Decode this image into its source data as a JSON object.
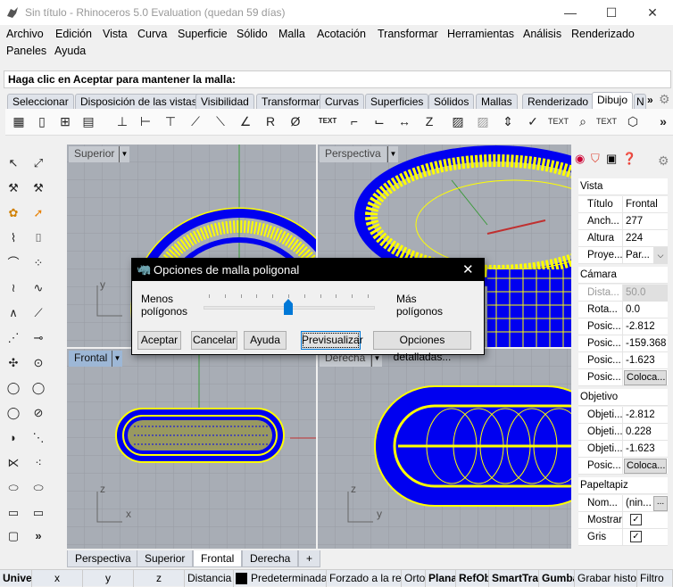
{
  "window": {
    "title": "Sin título - Rhinoceros 5.0 Evaluation (quedan 59 días)",
    "minimize": "—",
    "maximize": "☐",
    "close": "✕"
  },
  "menu": {
    "row1": [
      "Archivo",
      "Edición",
      "Vista",
      "Curva",
      "Superficie",
      "Sólido",
      "Malla",
      "Acotación",
      "Transformar",
      "Herramientas",
      "Análisis",
      "Renderizado"
    ],
    "row2": [
      "Paneles",
      "Ayuda"
    ]
  },
  "command": {
    "prompt": "Haga clic en Aceptar para mantener la malla:"
  },
  "toolbar_tabs": [
    {
      "label": "Seleccionar"
    },
    {
      "label": "Disposición de las vistas"
    },
    {
      "label": "Visibilidad"
    },
    {
      "label": "Transformar"
    },
    {
      "label": "Curvas"
    },
    {
      "label": "Superficies"
    },
    {
      "label": "Sólidos"
    },
    {
      "label": "Mallas"
    },
    {
      "label": "Renderizado"
    },
    {
      "label": "Dibujo",
      "active": true
    },
    {
      "label": "N"
    }
  ],
  "toolbar_more": "»",
  "toolbar_icons": [
    "layout-icon",
    "page-icon",
    "add-page-icon",
    "page-properties-icon",
    "dimension-vertical-icon",
    "dimension-horizontal-icon",
    "dimension-icon",
    "dimension-aligned-icon",
    "dimension-rotated-icon",
    "angle-45-icon",
    "radius-icon",
    "diameter-icon",
    "text-icon",
    "leader-2-icon",
    "leader-icon",
    "dimension-text-icon",
    "dimension-z-icon",
    "hatch-icon",
    "hatch-gray-icon",
    "dimension-edit-icon",
    "dimension-check-icon",
    "text-edit-icon",
    "text-find-icon",
    "text-text-icon",
    "make2d-icon"
  ],
  "toolbar_text": {
    "text1": "TEXT",
    "text2": "TEXT",
    "text3": "TEXT"
  },
  "viewports": {
    "top_left": {
      "label": "Superior",
      "axes": [
        "y",
        "x"
      ]
    },
    "top_right": {
      "label": "Perspectiva"
    },
    "bottom_left": {
      "label": "Frontal",
      "axes": [
        "z",
        "x"
      ],
      "active": true
    },
    "bottom_right": {
      "label": "Derecha",
      "axes": [
        "z",
        "y"
      ]
    }
  },
  "viewport_tabs": [
    {
      "label": "Perspectiva"
    },
    {
      "label": "Superior"
    },
    {
      "label": "Frontal",
      "active": true
    },
    {
      "label": "Derecha"
    }
  ],
  "viewport_tab_add": "+",
  "panel": {
    "sections": {
      "vista": "Vista",
      "camara": "Cámara",
      "objetivo": "Objetivo",
      "papeltapiz": "Papeltapiz"
    },
    "vista": [
      [
        "Título",
        "Frontal"
      ],
      [
        "Anch...",
        "277"
      ],
      [
        "Altura",
        "224"
      ],
      [
        "Proye...",
        "Par..."
      ]
    ],
    "camara": [
      [
        "Dista...",
        "50.0"
      ],
      [
        "Rota...",
        "0.0"
      ],
      [
        "Posic...",
        "-2.812"
      ],
      [
        "Posic...",
        "-159.368"
      ],
      [
        "Posic...",
        "-1.623"
      ],
      [
        "Posic...",
        "Coloca..."
      ]
    ],
    "objetivo": [
      [
        "Objeti...",
        "-2.812"
      ],
      [
        "Objeti...",
        "0.228"
      ],
      [
        "Objeti...",
        "-1.623"
      ],
      [
        "Posic...",
        "Coloca..."
      ]
    ],
    "papeltapiz": [
      [
        "Nom...",
        "(nin..."
      ],
      [
        "Mostrar",
        true
      ],
      [
        "Gris",
        true
      ]
    ],
    "browse": "...",
    "tab_icons": [
      "color-wheel-icon",
      "material-icon",
      "display-icon",
      "help-icon"
    ],
    "gear": "⚙"
  },
  "status": [
    "Unive",
    "x",
    "y",
    "z",
    "Distancia",
    "Predeterminada",
    "Forzado a la re",
    "Orto",
    "Planar",
    "RefObj",
    "SmartTrack",
    "Gumball",
    "Grabar historial",
    "Filtro"
  ],
  "dialog": {
    "title": "Opciones de malla poligonal",
    "less": [
      "Menos",
      "polígonos"
    ],
    "more": [
      "Más",
      "polígonos"
    ],
    "slider": {
      "ticks": 11,
      "value": 5,
      "max": 10,
      "color": "#0078d7"
    },
    "buttons": [
      "Aceptar",
      "Cancelar",
      "Ayuda",
      "Previsualizar",
      "Opciones detalladas..."
    ]
  },
  "colors": {
    "mesh_blue": "#0000f0",
    "mesh_yellow": "#ffff00",
    "viewport_bg": "#a8adb5",
    "active_label": "#9db7d6"
  }
}
